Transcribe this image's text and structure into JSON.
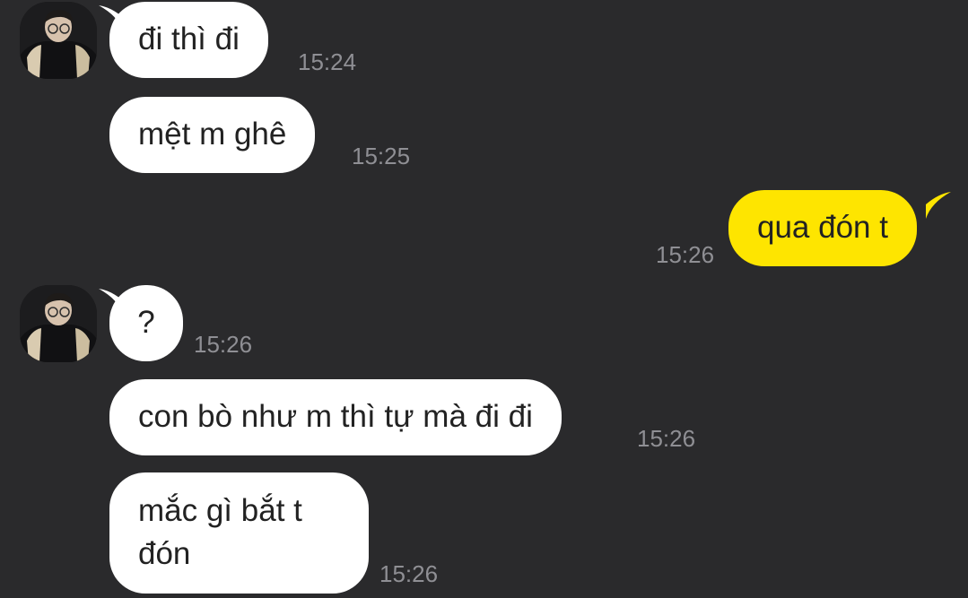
{
  "chat": {
    "colors": {
      "background": "#2a2a2c",
      "incoming_bubble": "#ffffff",
      "outgoing_bubble": "#fee500",
      "timestamp": "#8f8f94"
    },
    "messages": [
      {
        "direction": "incoming",
        "text": "đi thì đi",
        "time": "15:24",
        "show_avatar": true
      },
      {
        "direction": "incoming",
        "text": "mệt m ghê",
        "time": "15:25",
        "show_avatar": false
      },
      {
        "direction": "outgoing",
        "text": "qua đón t",
        "time": "15:26"
      },
      {
        "direction": "incoming",
        "text": "?",
        "time": "15:26",
        "show_avatar": true
      },
      {
        "direction": "incoming",
        "text": "con bò như m thì tự mà đi đi",
        "time": "15:26",
        "show_avatar": false
      },
      {
        "direction": "incoming",
        "lines": [
          "mắc gì bắt t",
          "đón"
        ],
        "time": "15:26",
        "show_avatar": false
      }
    ]
  }
}
